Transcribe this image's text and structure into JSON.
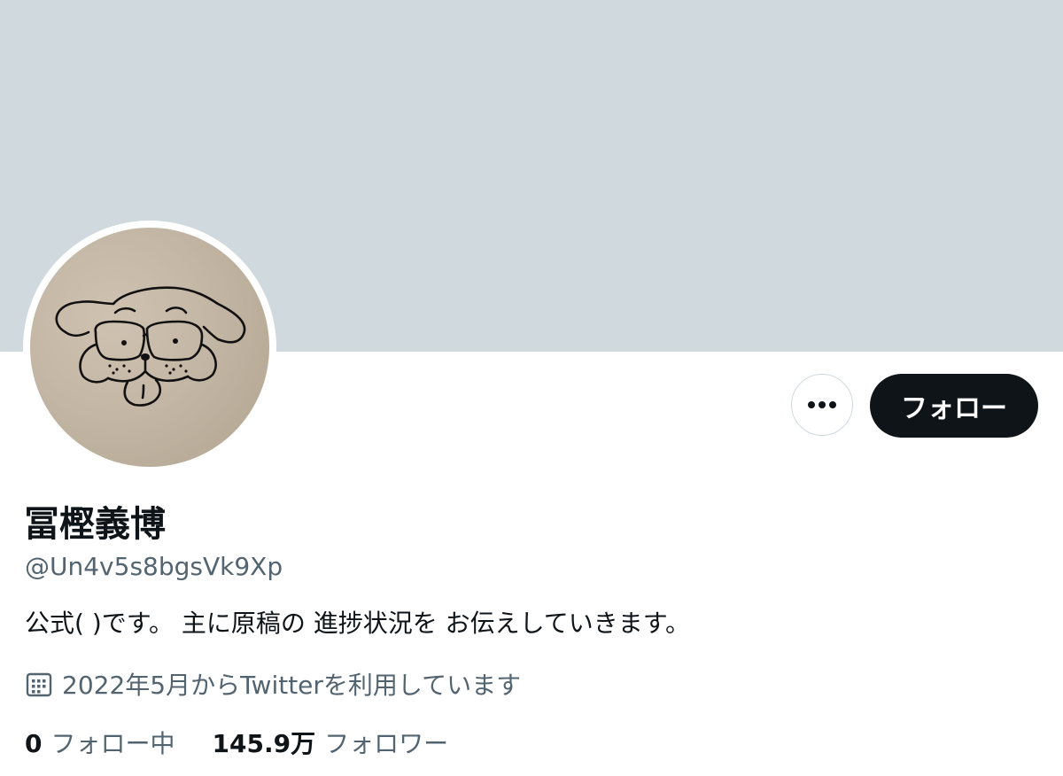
{
  "profile": {
    "display_name": "冨樫義博",
    "handle": "@Un4v5s8bgsVk9Xp",
    "bio": "公式( )です。 主に原稿の 進捗状況を お伝えしていきます。",
    "joined": "2022年5月からTwitterを利用しています",
    "avatar_icon": "dog-doodle-avatar"
  },
  "actions": {
    "follow_label": "フォロー",
    "more_icon": "more-horizontal-icon"
  },
  "stats": {
    "following_count": "0",
    "following_label": "フォロー中",
    "followers_count": "145.9万",
    "followers_label": "フォロワー"
  },
  "colors": {
    "banner": "#cfd9de",
    "text_primary": "#0f1419",
    "text_secondary": "#536471",
    "follow_button_bg": "#0f1419",
    "follow_button_text": "#ffffff"
  }
}
